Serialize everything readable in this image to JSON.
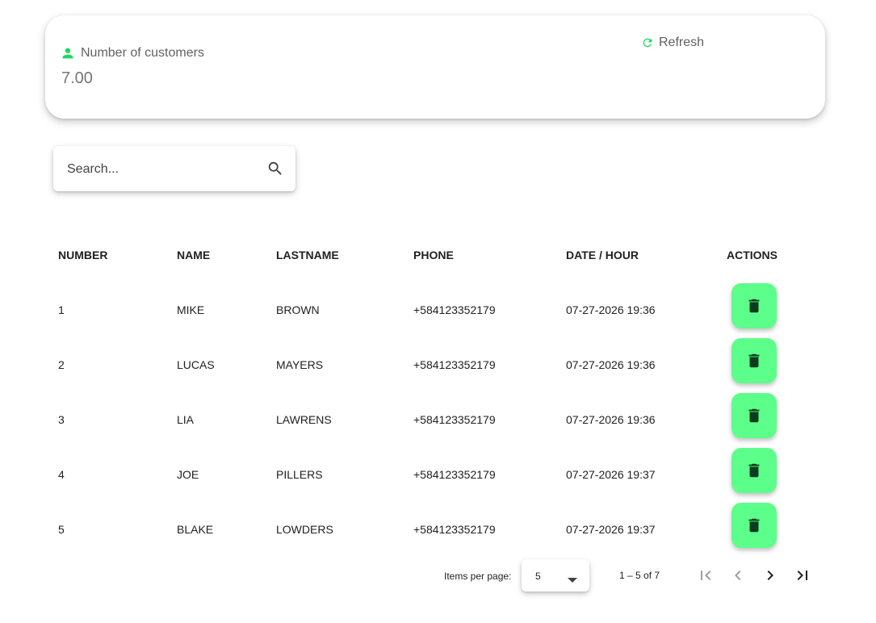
{
  "stats": {
    "label": "Number of customers",
    "value": "7.00",
    "refresh_label": "Refresh",
    "accent_color": "#1ed760"
  },
  "search": {
    "placeholder": "Search...",
    "value": ""
  },
  "table": {
    "headers": [
      "NUMBER",
      "NAME",
      "LASTNAME",
      "PHONE",
      "DATE / HOUR",
      "ACTIONS"
    ],
    "rows": [
      {
        "number": "1",
        "name": "MIKE",
        "lastname": "BROWN",
        "phone": "+584123352179",
        "date": "07-27-2026 19:36"
      },
      {
        "number": "2",
        "name": "LUCAS",
        "lastname": "MAYERS",
        "phone": "+584123352179",
        "date": "07-27-2026 19:36"
      },
      {
        "number": "3",
        "name": "LIA",
        "lastname": "LAWRENS",
        "phone": "+584123352179",
        "date": "07-27-2026 19:36"
      },
      {
        "number": "4",
        "name": "JOE",
        "lastname": "PILLERS",
        "phone": "+584123352179",
        "date": "07-27-2026 19:37"
      },
      {
        "number": "5",
        "name": "BLAKE",
        "lastname": "LOWDERS",
        "phone": "+584123352179",
        "date": "07-27-2026 19:37"
      }
    ],
    "delete_icon": "trash-icon",
    "delete_button_color": "#5cff8a"
  },
  "paginator": {
    "items_per_page_label": "Items per page:",
    "items_per_page_value": "5",
    "range_label": "1 – 5 of 7"
  }
}
